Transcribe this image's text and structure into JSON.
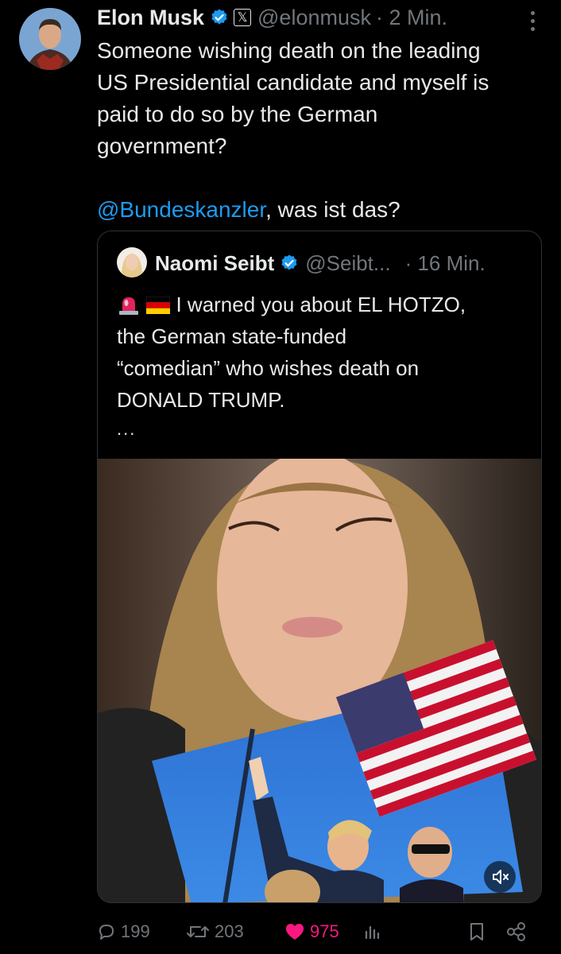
{
  "post": {
    "author_name": "Elon Musk",
    "handle": "@elonmusk",
    "time": "· 2 Min.",
    "text_line1": "Someone wishing death on the leading",
    "text_line2": "US Presidential candidate and myself is",
    "text_line3": "paid to do so by the German",
    "text_line4": "government?",
    "mention": "@Bundeskanzler",
    "text_after_mention": ", was ist das?"
  },
  "quote": {
    "author_name": "Naomi Seibt",
    "handle": "@Seibt...",
    "time": "· 16 Min.",
    "line1": "I warned you about EL HOTZO,",
    "line2": "the German state-funded",
    "line3": "“comedian” who wishes death on",
    "line4": "DONALD TRUMP.",
    "more": "..."
  },
  "actions": {
    "replies": "199",
    "reposts": "203",
    "likes": "975"
  },
  "colors": {
    "accent": "#1d9bf0",
    "like": "#f91880",
    "muted": "#71767b"
  }
}
